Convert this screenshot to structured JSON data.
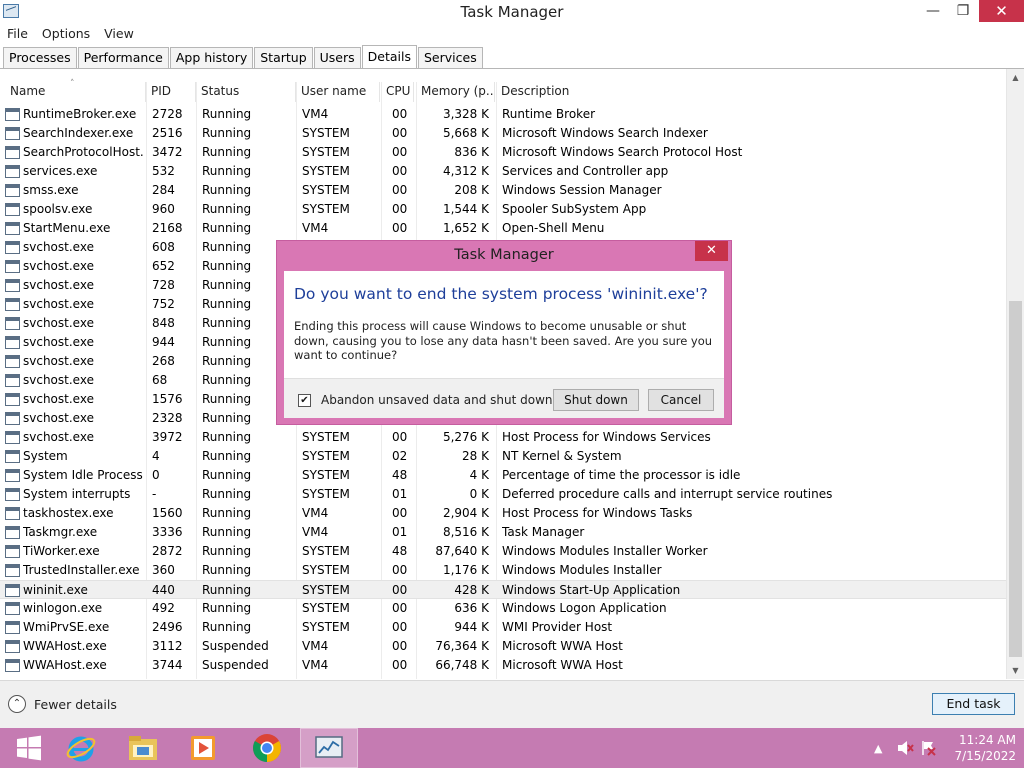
{
  "window": {
    "title": "Task Manager",
    "minimize_glyph": "—",
    "maximize_glyph": "❐",
    "close_glyph": "✕"
  },
  "menu": [
    "File",
    "Options",
    "View"
  ],
  "tabs": [
    "Processes",
    "Performance",
    "App history",
    "Startup",
    "Users",
    "Details",
    "Services"
  ],
  "active_tab": "Details",
  "columns": [
    "Name",
    "PID",
    "Status",
    "User name",
    "CPU",
    "Memory (p...",
    "Description"
  ],
  "rows": [
    {
      "name": "RuntimeBroker.exe",
      "pid": "2728",
      "status": "Running",
      "user": "VM4",
      "cpu": "00",
      "mem": "3,328 K",
      "desc": "Runtime Broker",
      "icon": "process-window-icon"
    },
    {
      "name": "SearchIndexer.exe",
      "pid": "2516",
      "status": "Running",
      "user": "SYSTEM",
      "cpu": "00",
      "mem": "5,668 K",
      "desc": "Microsoft Windows Search Indexer",
      "icon": "search-user-icon"
    },
    {
      "name": "SearchProtocolHost....",
      "pid": "3472",
      "status": "Running",
      "user": "SYSTEM",
      "cpu": "00",
      "mem": "836 K",
      "desc": "Microsoft Windows Search Protocol Host",
      "icon": "search-user-icon"
    },
    {
      "name": "services.exe",
      "pid": "532",
      "status": "Running",
      "user": "SYSTEM",
      "cpu": "00",
      "mem": "4,312 K",
      "desc": "Services and Controller app",
      "icon": "process-window-icon"
    },
    {
      "name": "smss.exe",
      "pid": "284",
      "status": "Running",
      "user": "SYSTEM",
      "cpu": "00",
      "mem": "208 K",
      "desc": "Windows Session Manager",
      "icon": "process-window-icon"
    },
    {
      "name": "spoolsv.exe",
      "pid": "960",
      "status": "Running",
      "user": "SYSTEM",
      "cpu": "00",
      "mem": "1,544 K",
      "desc": "Spooler SubSystem App",
      "icon": "printer-icon"
    },
    {
      "name": "StartMenu.exe",
      "pid": "2168",
      "status": "Running",
      "user": "VM4",
      "cpu": "00",
      "mem": "1,652 K",
      "desc": "Open-Shell Menu",
      "icon": "shell-orb-icon"
    },
    {
      "name": "svchost.exe",
      "pid": "608",
      "status": "Running",
      "user": "",
      "cpu": "",
      "mem": "",
      "desc": "",
      "icon": "process-window-icon"
    },
    {
      "name": "svchost.exe",
      "pid": "652",
      "status": "Running",
      "user": "",
      "cpu": "",
      "mem": "",
      "desc": "",
      "icon": "process-window-icon"
    },
    {
      "name": "svchost.exe",
      "pid": "728",
      "status": "Running",
      "user": "",
      "cpu": "",
      "mem": "",
      "desc": "",
      "icon": "process-window-icon"
    },
    {
      "name": "svchost.exe",
      "pid": "752",
      "status": "Running",
      "user": "",
      "cpu": "",
      "mem": "",
      "desc": "",
      "icon": "process-window-icon"
    },
    {
      "name": "svchost.exe",
      "pid": "848",
      "status": "Running",
      "user": "",
      "cpu": "",
      "mem": "",
      "desc": "",
      "icon": "process-window-icon"
    },
    {
      "name": "svchost.exe",
      "pid": "944",
      "status": "Running",
      "user": "",
      "cpu": "",
      "mem": "",
      "desc": "",
      "icon": "process-window-icon"
    },
    {
      "name": "svchost.exe",
      "pid": "268",
      "status": "Running",
      "user": "",
      "cpu": "",
      "mem": "",
      "desc": "",
      "icon": "process-window-icon"
    },
    {
      "name": "svchost.exe",
      "pid": "68",
      "status": "Running",
      "user": "",
      "cpu": "",
      "mem": "",
      "desc": "",
      "icon": "process-window-icon"
    },
    {
      "name": "svchost.exe",
      "pid": "1576",
      "status": "Running",
      "user": "",
      "cpu": "",
      "mem": "",
      "desc": "",
      "icon": "process-window-icon"
    },
    {
      "name": "svchost.exe",
      "pid": "2328",
      "status": "Running",
      "user": "",
      "cpu": "",
      "mem": "",
      "desc": "",
      "icon": "process-window-icon"
    },
    {
      "name": "svchost.exe",
      "pid": "3972",
      "status": "Running",
      "user": "SYSTEM",
      "cpu": "00",
      "mem": "5,276 K",
      "desc": "Host Process for Windows Services",
      "icon": "process-window-icon"
    },
    {
      "name": "System",
      "pid": "4",
      "status": "Running",
      "user": "SYSTEM",
      "cpu": "02",
      "mem": "28 K",
      "desc": "NT Kernel & System",
      "icon": "process-window-icon"
    },
    {
      "name": "System Idle Process",
      "pid": "0",
      "status": "Running",
      "user": "SYSTEM",
      "cpu": "48",
      "mem": "4 K",
      "desc": "Percentage of time the processor is idle",
      "icon": "process-window-icon"
    },
    {
      "name": "System interrupts",
      "pid": "-",
      "status": "Running",
      "user": "SYSTEM",
      "cpu": "01",
      "mem": "0 K",
      "desc": "Deferred procedure calls and interrupt service routines",
      "icon": "process-window-icon"
    },
    {
      "name": "taskhostex.exe",
      "pid": "1560",
      "status": "Running",
      "user": "VM4",
      "cpu": "00",
      "mem": "2,904 K",
      "desc": "Host Process for Windows Tasks",
      "icon": "process-window-icon"
    },
    {
      "name": "Taskmgr.exe",
      "pid": "3336",
      "status": "Running",
      "user": "VM4",
      "cpu": "01",
      "mem": "8,516 K",
      "desc": "Task Manager",
      "icon": "task-manager-icon"
    },
    {
      "name": "TiWorker.exe",
      "pid": "2872",
      "status": "Running",
      "user": "SYSTEM",
      "cpu": "48",
      "mem": "87,640 K",
      "desc": "Windows Modules Installer Worker",
      "icon": "process-window-icon"
    },
    {
      "name": "TrustedInstaller.exe",
      "pid": "360",
      "status": "Running",
      "user": "SYSTEM",
      "cpu": "00",
      "mem": "1,176 K",
      "desc": "Windows Modules Installer",
      "icon": "process-window-icon"
    },
    {
      "name": "wininit.exe",
      "pid": "440",
      "status": "Running",
      "user": "SYSTEM",
      "cpu": "00",
      "mem": "428 K",
      "desc": "Windows Start-Up Application",
      "icon": "process-window-icon",
      "selected": true
    },
    {
      "name": "winlogon.exe",
      "pid": "492",
      "status": "Running",
      "user": "SYSTEM",
      "cpu": "00",
      "mem": "636 K",
      "desc": "Windows Logon Application",
      "icon": "process-window-icon"
    },
    {
      "name": "WmiPrvSE.exe",
      "pid": "2496",
      "status": "Running",
      "user": "SYSTEM",
      "cpu": "00",
      "mem": "944 K",
      "desc": "WMI Provider Host",
      "icon": "wmi-provider-icon"
    },
    {
      "name": "WWAHost.exe",
      "pid": "3112",
      "status": "Suspended",
      "user": "VM4",
      "cpu": "00",
      "mem": "76,364 K",
      "desc": "Microsoft WWA Host",
      "icon": "process-window-icon"
    },
    {
      "name": "WWAHost.exe",
      "pid": "3744",
      "status": "Suspended",
      "user": "VM4",
      "cpu": "00",
      "mem": "66,748 K",
      "desc": "Microsoft WWA Host",
      "icon": "process-window-icon"
    }
  ],
  "footer": {
    "fewer_details": "Fewer details",
    "fewer_glyph": "⌃",
    "end_task": "End task"
  },
  "dialog": {
    "title": "Task Manager",
    "close_glyph": "✕",
    "heading": "Do you want to end the system process 'wininit.exe'?",
    "body": "Ending this process will cause Windows to become unusable or shut down, causing you to lose any data hasn't been saved. Are you sure you want to continue?",
    "checkbox_label": "Abandon unsaved data and shut down.",
    "checkbox_checked": true,
    "check_glyph": "✔",
    "shutdown_label": "Shut down",
    "cancel_label": "Cancel"
  },
  "taskbar": {
    "apps": [
      "windows-start-icon",
      "internet-explorer-icon",
      "file-explorer-icon",
      "media-player-icon",
      "chrome-icon",
      "task-manager-icon"
    ],
    "active_app": "task-manager-icon",
    "clock_time": "11:24 AM",
    "clock_date": "7/15/2022"
  },
  "colors": {
    "accent_pink": "#d977b4",
    "taskbar": "#c57bb2",
    "close_red": "#c7324a",
    "dialog_heading_blue": "#1e3f9a"
  }
}
